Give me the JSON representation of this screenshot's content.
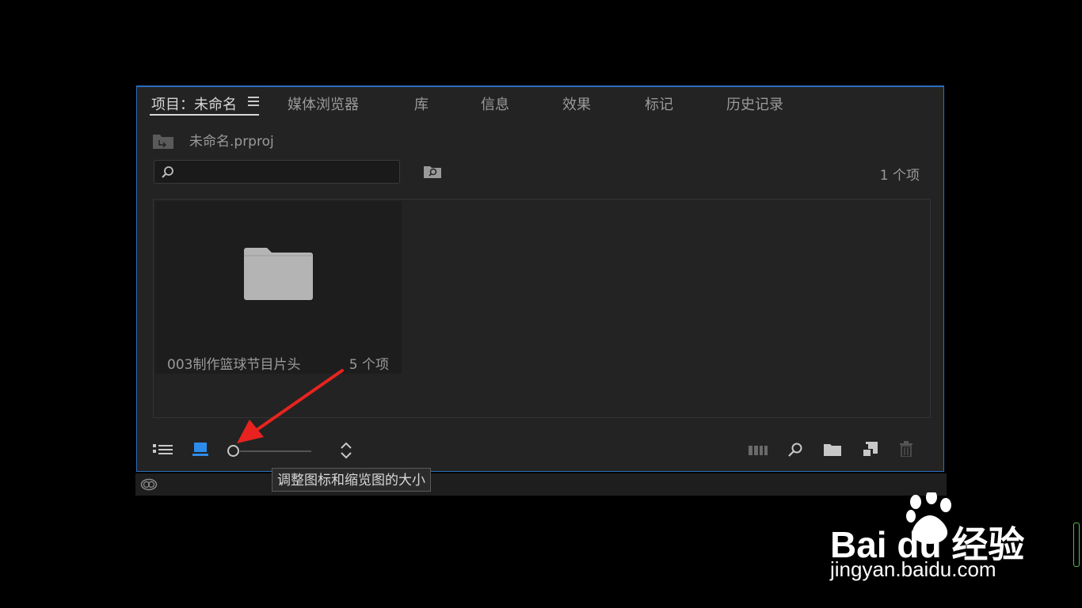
{
  "tabs": [
    {
      "label": "项目：未命名",
      "active": true
    },
    {
      "label": "媒体浏览器"
    },
    {
      "label": "库"
    },
    {
      "label": "信息"
    },
    {
      "label": "效果"
    },
    {
      "label": "标记"
    },
    {
      "label": "历史记录"
    }
  ],
  "project": {
    "file_name": "未命名.prproj",
    "item_count": "1 个项"
  },
  "search": {
    "placeholder": ""
  },
  "bin": {
    "name": "003制作篮球节目片头",
    "count": "5 个项"
  },
  "tooltip": {
    "text": "调整图标和缩览图的大小"
  },
  "zoom_slider": {
    "value_fraction": 0.0
  },
  "colors": {
    "accent": "#2b6fbf",
    "arrow": "#e8231f",
    "panel_bg": "#232323"
  },
  "watermark": {
    "brand": "Bai du 经验",
    "url": "jingyan.baidu.com"
  }
}
